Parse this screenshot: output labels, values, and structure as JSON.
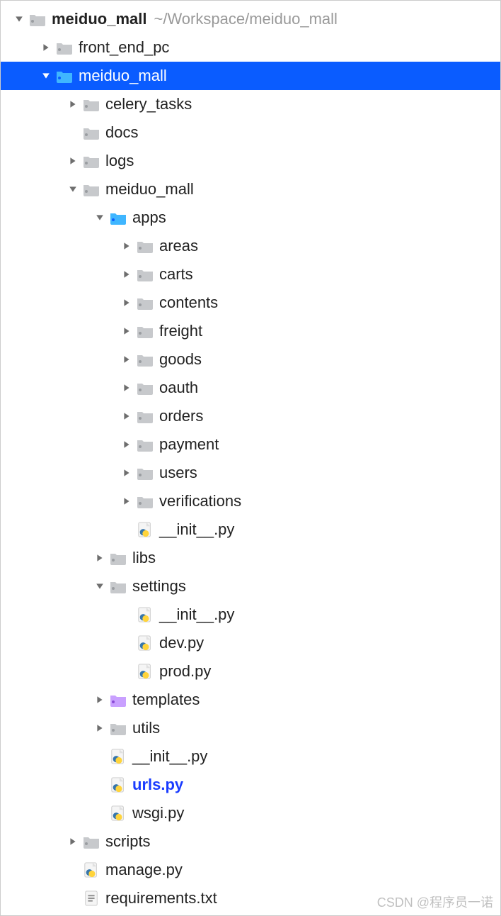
{
  "watermark": "CSDN @程序员一诺",
  "tree": [
    {
      "depth": 0,
      "arrow": "down",
      "icon": "folder-gray",
      "label": "meiduo_mall",
      "bold": true,
      "path": "~/Workspace/meiduo_mall"
    },
    {
      "depth": 1,
      "arrow": "right",
      "icon": "folder-gray",
      "label": "front_end_pc"
    },
    {
      "depth": 1,
      "arrow": "down-white",
      "icon": "folder-blue",
      "label": "meiduo_mall",
      "selected": true
    },
    {
      "depth": 2,
      "arrow": "right",
      "icon": "folder-gray",
      "label": "celery_tasks"
    },
    {
      "depth": 2,
      "arrow": "none",
      "icon": "folder-gray",
      "label": "docs"
    },
    {
      "depth": 2,
      "arrow": "right",
      "icon": "folder-gray",
      "label": "logs"
    },
    {
      "depth": 2,
      "arrow": "down",
      "icon": "folder-gray",
      "label": "meiduo_mall"
    },
    {
      "depth": 3,
      "arrow": "down",
      "icon": "folder-blue",
      "label": "apps"
    },
    {
      "depth": 4,
      "arrow": "right",
      "icon": "folder-gray",
      "label": "areas"
    },
    {
      "depth": 4,
      "arrow": "right",
      "icon": "folder-gray",
      "label": "carts"
    },
    {
      "depth": 4,
      "arrow": "right",
      "icon": "folder-gray",
      "label": "contents"
    },
    {
      "depth": 4,
      "arrow": "right",
      "icon": "folder-gray",
      "label": "freight"
    },
    {
      "depth": 4,
      "arrow": "right",
      "icon": "folder-gray",
      "label": "goods"
    },
    {
      "depth": 4,
      "arrow": "right",
      "icon": "folder-gray",
      "label": "oauth"
    },
    {
      "depth": 4,
      "arrow": "right",
      "icon": "folder-gray",
      "label": "orders"
    },
    {
      "depth": 4,
      "arrow": "right",
      "icon": "folder-gray",
      "label": "payment"
    },
    {
      "depth": 4,
      "arrow": "right",
      "icon": "folder-gray",
      "label": "users"
    },
    {
      "depth": 4,
      "arrow": "right",
      "icon": "folder-gray",
      "label": "verifications"
    },
    {
      "depth": 4,
      "arrow": "none",
      "icon": "python",
      "label": "__init__.py"
    },
    {
      "depth": 3,
      "arrow": "right",
      "icon": "folder-gray",
      "label": "libs"
    },
    {
      "depth": 3,
      "arrow": "down",
      "icon": "folder-gray",
      "label": "settings"
    },
    {
      "depth": 4,
      "arrow": "none",
      "icon": "python",
      "label": "__init__.py"
    },
    {
      "depth": 4,
      "arrow": "none",
      "icon": "python",
      "label": "dev.py"
    },
    {
      "depth": 4,
      "arrow": "none",
      "icon": "python",
      "label": "prod.py"
    },
    {
      "depth": 3,
      "arrow": "right",
      "icon": "folder-purple",
      "label": "templates"
    },
    {
      "depth": 3,
      "arrow": "right",
      "icon": "folder-gray",
      "label": "utils"
    },
    {
      "depth": 3,
      "arrow": "none",
      "icon": "python",
      "label": "__init__.py"
    },
    {
      "depth": 3,
      "arrow": "none",
      "icon": "python",
      "label": "urls.py",
      "link": true
    },
    {
      "depth": 3,
      "arrow": "none",
      "icon": "python",
      "label": "wsgi.py"
    },
    {
      "depth": 2,
      "arrow": "right",
      "icon": "folder-gray",
      "label": "scripts"
    },
    {
      "depth": 2,
      "arrow": "none",
      "icon": "python",
      "label": "manage.py"
    },
    {
      "depth": 2,
      "arrow": "none",
      "icon": "textfile",
      "label": "requirements.txt"
    }
  ]
}
